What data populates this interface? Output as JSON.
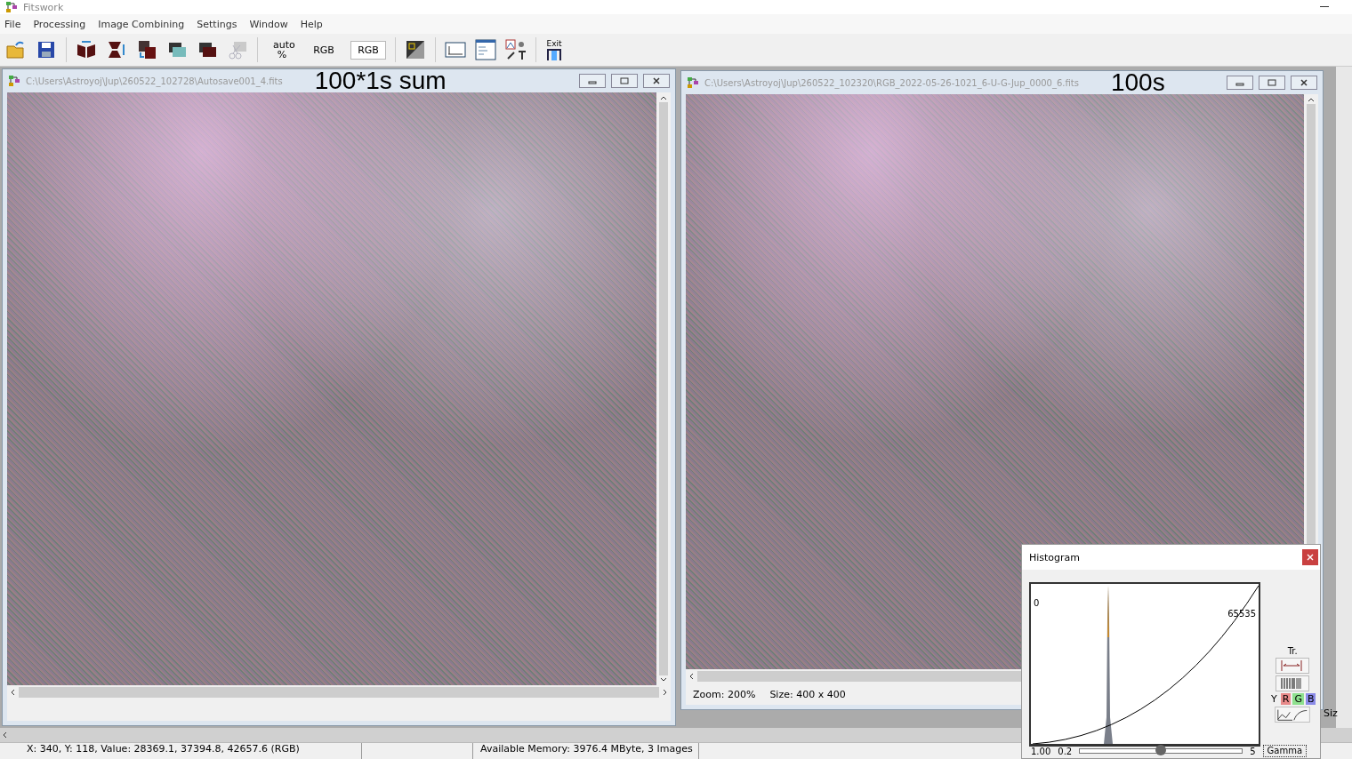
{
  "window": {
    "title": "Fitswork"
  },
  "menu": [
    "File",
    "Processing",
    "Image Combining",
    "Settings",
    "Window",
    "Help"
  ],
  "toolbar": {
    "auto_button": {
      "label": "auto %"
    },
    "rgb_buttons": [
      {
        "label": "RGB",
        "selected": false
      },
      {
        "label": "RGB",
        "selected": true
      }
    ],
    "exit_label": "Exit"
  },
  "documents": [
    {
      "path": "C:\\Users\\Astroyoj\\Jup\\260522_102728\\Autosave001_4.fits",
      "note": "100*1s  sum"
    },
    {
      "path": "C:\\Users\\Astroyoj\\Jup\\260522_102320\\RGB_2022-05-26-1021_6-U-G-Jup_0000_6.fits",
      "note": "100s",
      "status": [
        "Zoom: 200%",
        "Size: 400 x 400"
      ]
    }
  ],
  "histogram": {
    "title": "Histogram",
    "min_label": "0",
    "max_label": "65535",
    "tr_label": "Tr.",
    "channels": [
      {
        "label": "Y",
        "color": "#f0f0f0"
      },
      {
        "label": "R",
        "color": "#e88a8a"
      },
      {
        "label": "G",
        "color": "#8ee08e"
      },
      {
        "label": "B",
        "color": "#8a8ae8"
      }
    ],
    "gamma": {
      "value": "1.00",
      "min": "0.2",
      "max": "5",
      "level": 0.5,
      "button": "Gamma"
    },
    "side_label": "Siz"
  },
  "status_bar": [
    "X: 340, Y: 118, Value: 28369.1, 37394.8, 42657.6 (RGB)",
    "Available Memory: 3976.4 MByte, 3 Images"
  ]
}
